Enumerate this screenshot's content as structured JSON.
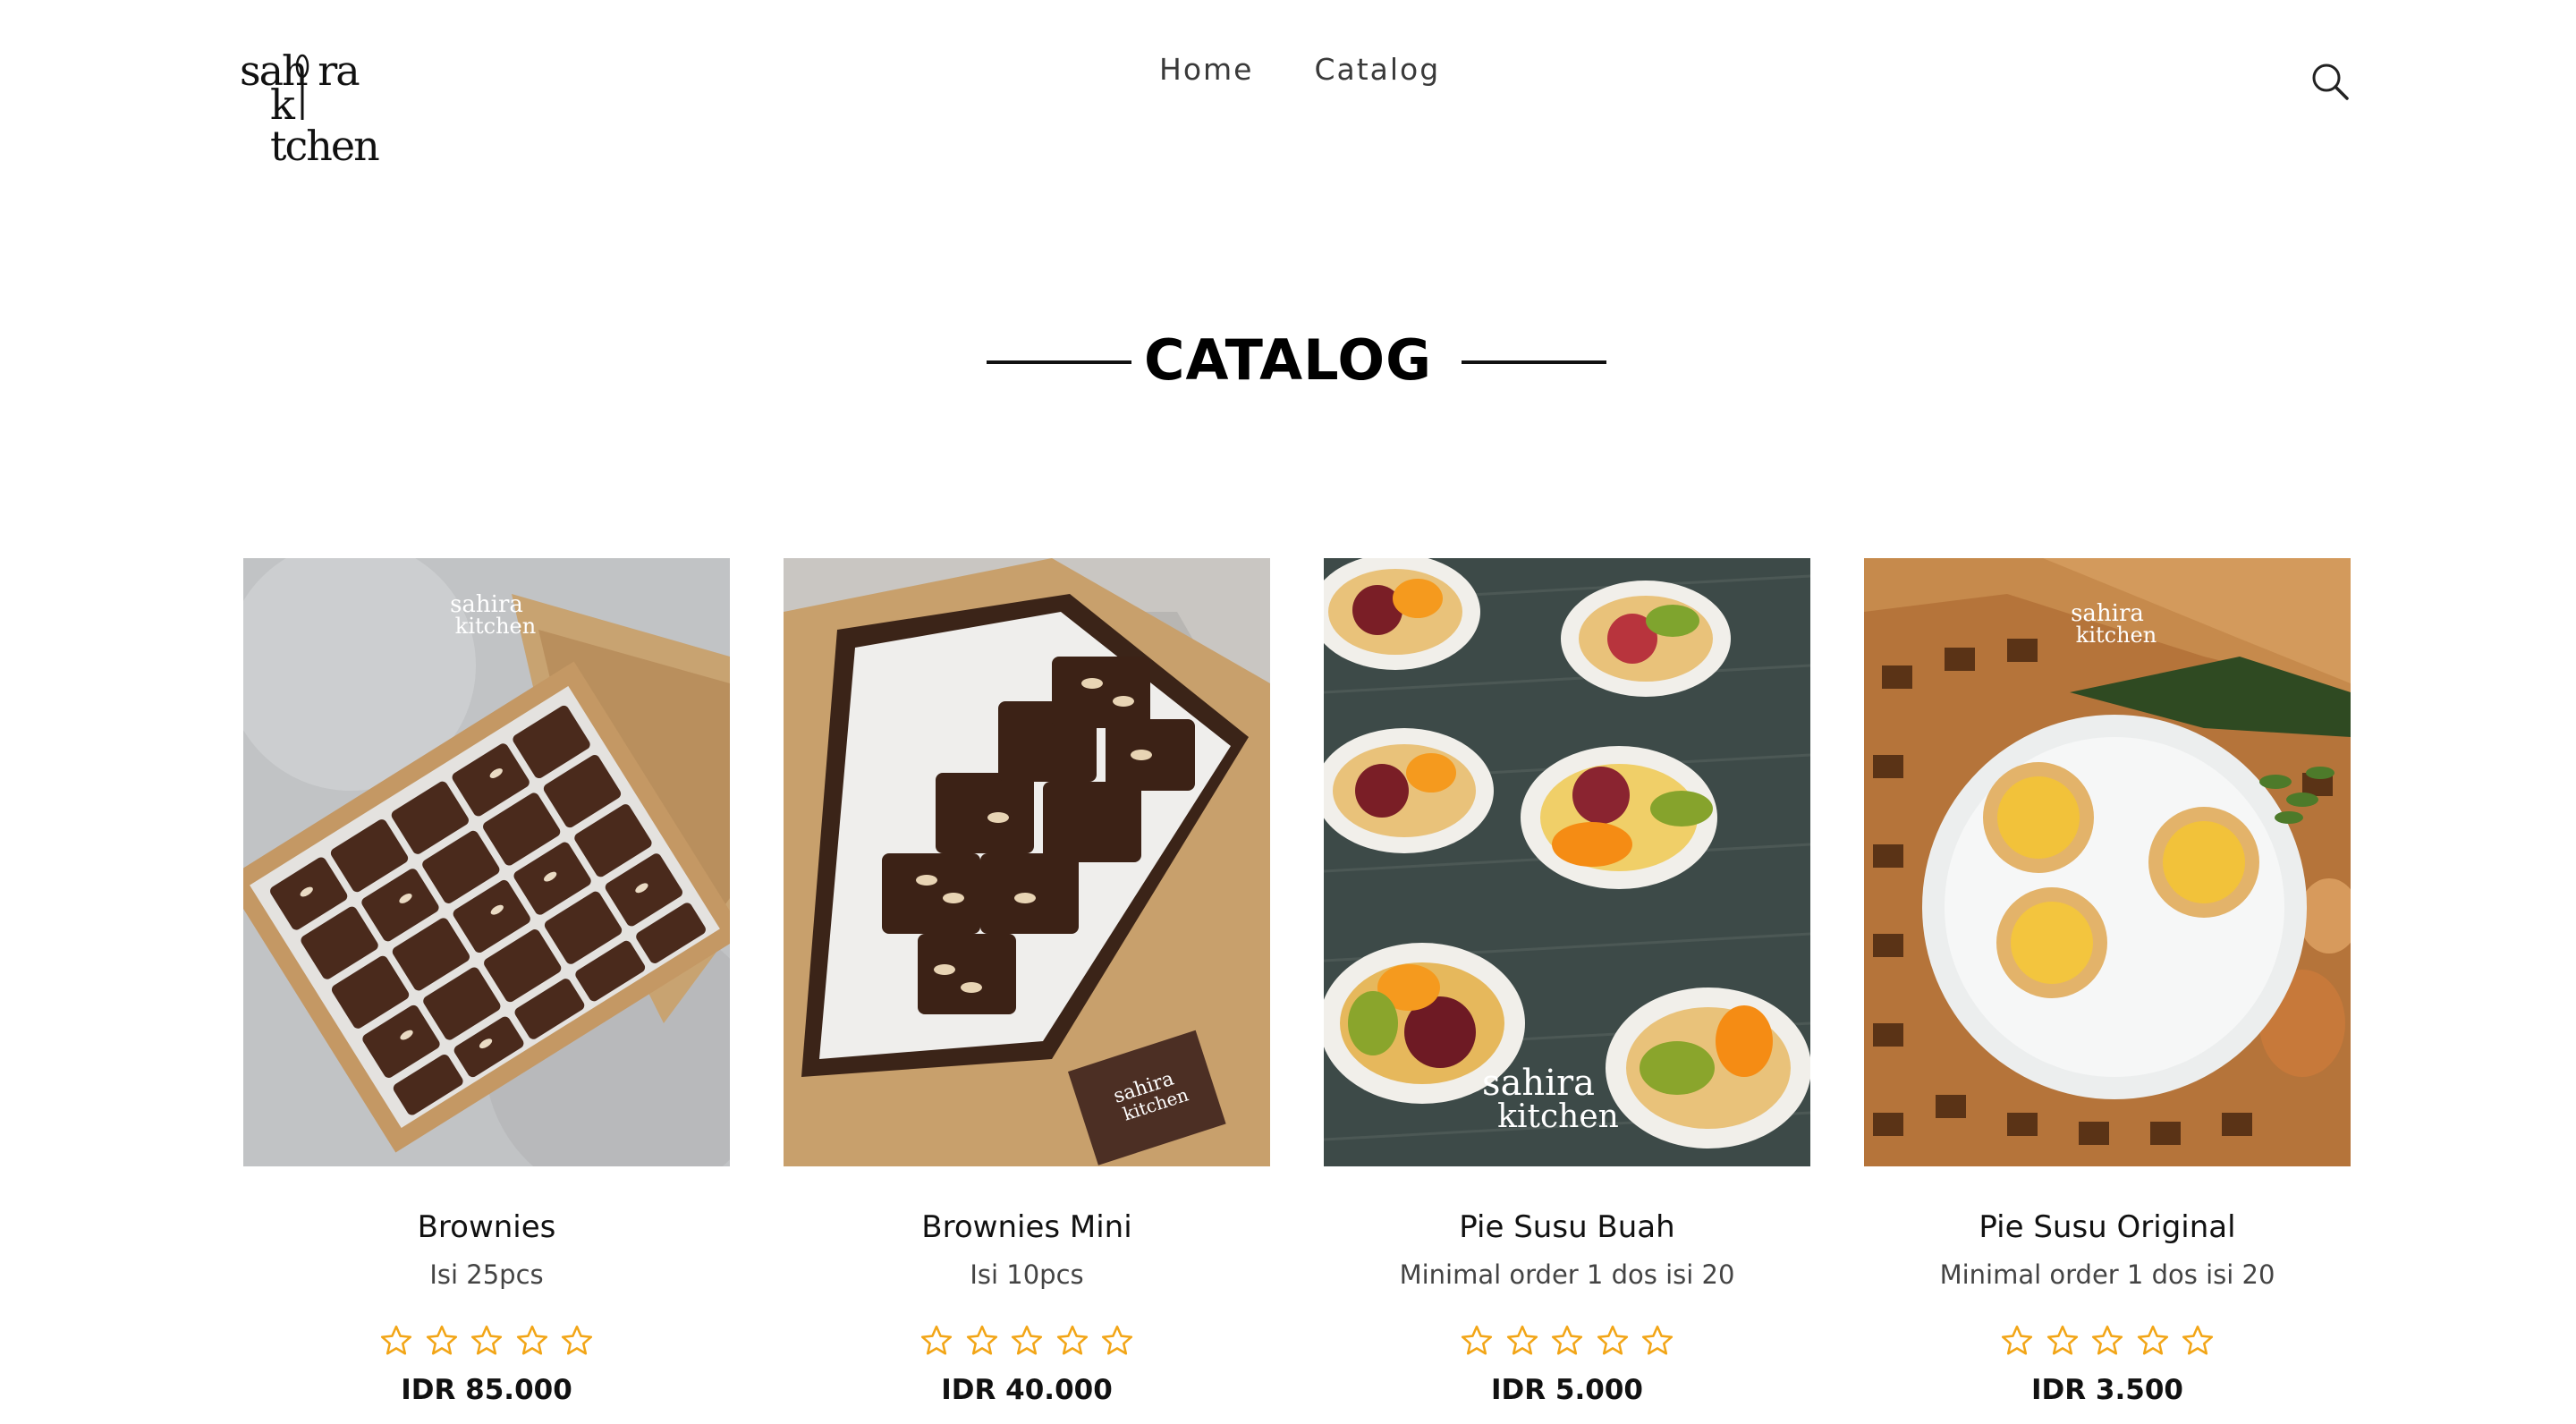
{
  "brand": {
    "logo_line1": "sahira",
    "logo_line2": "kitchen"
  },
  "nav": {
    "items": [
      {
        "label": "Home"
      },
      {
        "label": "Catalog"
      }
    ]
  },
  "page": {
    "title": "CATALOG"
  },
  "colors": {
    "star": "#f2a516",
    "text": "#111111",
    "nav_text": "#3a3a3a"
  },
  "products": [
    {
      "name": "Brownies",
      "description": "Isi 25pcs",
      "price": "IDR 85.000",
      "rating": 0,
      "rating_max": 5
    },
    {
      "name": "Brownies Mini",
      "description": "Isi 10pcs",
      "price": "IDR 40.000",
      "rating": 0,
      "rating_max": 5
    },
    {
      "name": "Pie Susu Buah",
      "description": "Minimal order 1 dos isi 20",
      "price": "IDR 5.000",
      "rating": 0,
      "rating_max": 5
    },
    {
      "name": "Pie Susu Original",
      "description": "Minimal order 1 dos isi 20",
      "price": "IDR 3.500",
      "rating": 0,
      "rating_max": 5
    }
  ]
}
